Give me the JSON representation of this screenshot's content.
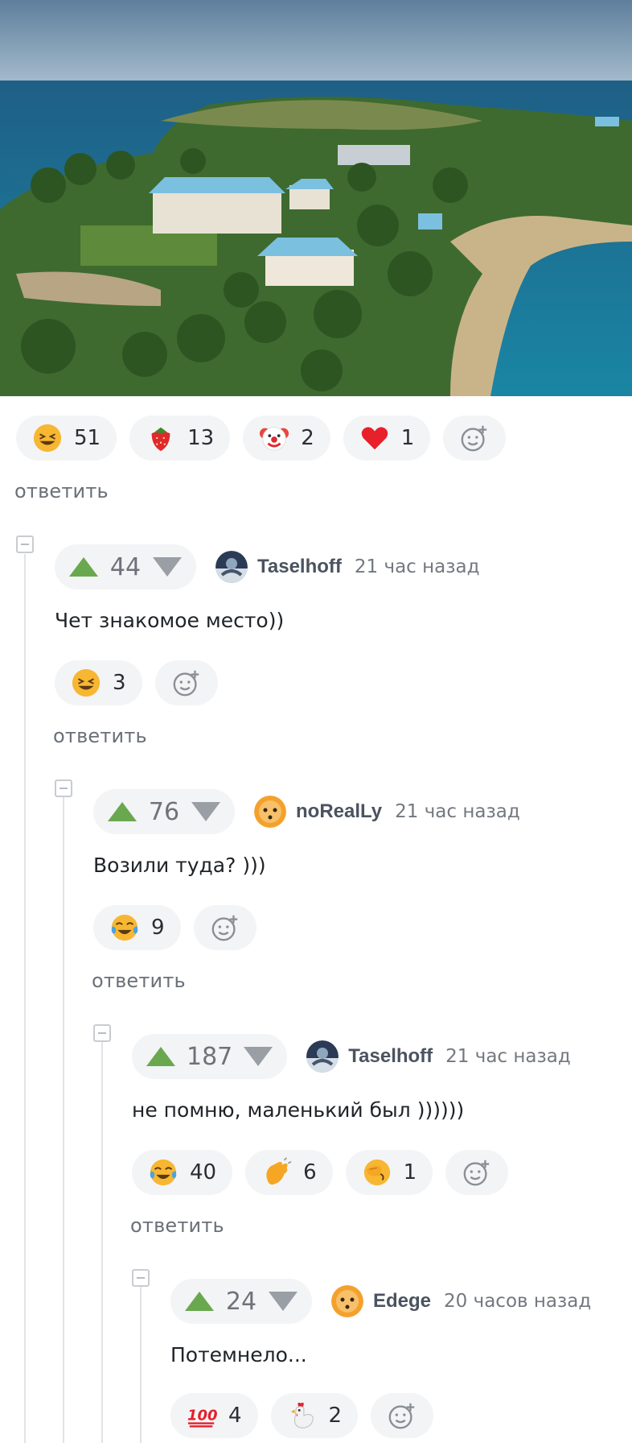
{
  "post_reactions": [
    {
      "icon": "grinning-squint-emoji",
      "count": "51"
    },
    {
      "icon": "strawberry-emoji",
      "count": "13"
    },
    {
      "icon": "clown-emoji",
      "count": "2"
    },
    {
      "icon": "heart-emoji",
      "count": "1"
    }
  ],
  "reply_label": "ответить",
  "comments": [
    {
      "rating": "44",
      "author": "Taselhoff",
      "time": "21 час назад",
      "text": "Чет знакомое место))",
      "reactions": [
        {
          "icon": "grinning-squint-emoji",
          "count": "3"
        }
      ]
    },
    {
      "rating": "76",
      "author": "noRealLy",
      "time": "21 час назад",
      "text": "Возили туда? )))",
      "reactions": [
        {
          "icon": "tears-of-joy-emoji",
          "count": "9"
        }
      ]
    },
    {
      "rating": "187",
      "author": "Taselhoff",
      "time": "21 час назад",
      "text": "не помню, маленький был ))))))",
      "reactions": [
        {
          "icon": "tears-of-joy-emoji",
          "count": "40"
        },
        {
          "icon": "clapping-hands-emoji",
          "count": "6"
        },
        {
          "icon": "facepalm-emoji",
          "count": "1"
        }
      ]
    },
    {
      "rating": "24",
      "author": "Edege",
      "time": "20 часов назад",
      "text": "Потемнело...",
      "reactions": [
        {
          "icon": "hundred-points-emoji",
          "count": "4"
        },
        {
          "icon": "rooster-emoji",
          "count": "2"
        }
      ]
    }
  ],
  "colors": {
    "upvote": "#6aa84f",
    "downvote": "#9a9ea5",
    "pill_bg": "#f3f4f6",
    "thread_line": "#e1e3e6"
  }
}
